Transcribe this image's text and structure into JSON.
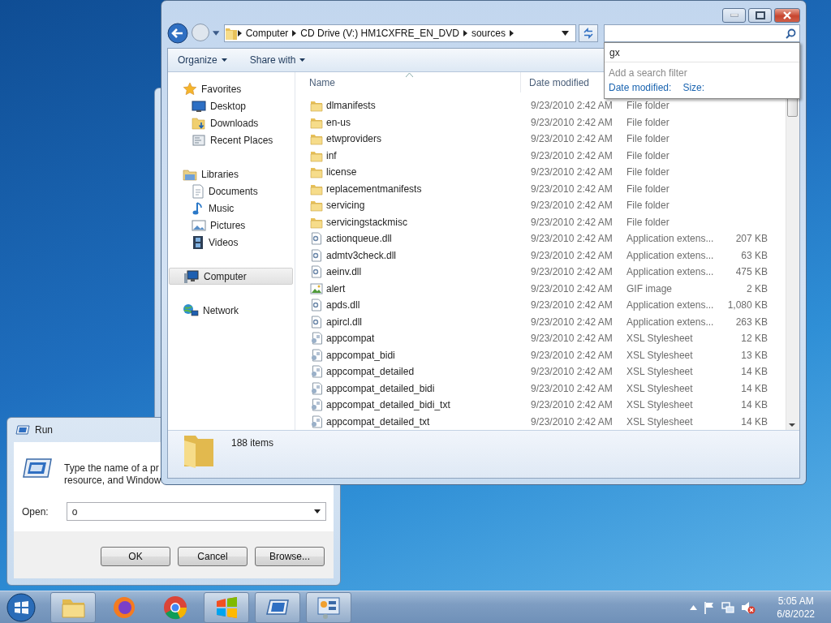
{
  "explorer": {
    "breadcrumbs": [
      "Computer",
      "CD Drive (V:) HM1CXFRE_EN_DVD",
      "sources"
    ],
    "search_dropdown": {
      "history": [
        "gx"
      ],
      "hint": "Add a search filter",
      "filters": [
        "Date modified:",
        "Size:"
      ]
    },
    "toolbar": [
      "Organize",
      "Share with"
    ],
    "sidebar": [
      {
        "label": "Favorites",
        "selected": false,
        "children": [
          {
            "label": "Desktop",
            "selected": false
          },
          {
            "label": "Downloads",
            "selected": false
          },
          {
            "label": "Recent Places",
            "selected": false
          }
        ]
      },
      {
        "label": "Libraries",
        "selected": false,
        "children": [
          {
            "label": "Documents",
            "selected": false
          },
          {
            "label": "Music",
            "selected": false
          },
          {
            "label": "Pictures",
            "selected": false
          },
          {
            "label": "Videos",
            "selected": false
          }
        ]
      },
      {
        "label": "Computer",
        "selected": true
      },
      {
        "label": "Network",
        "selected": false
      }
    ],
    "columns": [
      "Name",
      "Date modified"
    ],
    "rows": [
      {
        "kind": "folder",
        "name": "dlmanifests",
        "date": "9/23/2010 2:42 AM",
        "type": "File folder"
      },
      {
        "kind": "folder",
        "name": "en-us",
        "date": "9/23/2010 2:42 AM",
        "type": "File folder"
      },
      {
        "kind": "folder",
        "name": "etwproviders",
        "date": "9/23/2010 2:42 AM",
        "type": "File folder"
      },
      {
        "kind": "folder",
        "name": "inf",
        "date": "9/23/2010 2:42 AM",
        "type": "File folder"
      },
      {
        "kind": "folder",
        "name": "license",
        "date": "9/23/2010 2:42 AM",
        "type": "File folder"
      },
      {
        "kind": "folder",
        "name": "replacementmanifests",
        "date": "9/23/2010 2:42 AM",
        "type": "File folder"
      },
      {
        "kind": "folder",
        "name": "servicing",
        "date": "9/23/2010 2:42 AM",
        "type": "File folder"
      },
      {
        "kind": "folder",
        "name": "servicingstackmisc",
        "date": "9/23/2010 2:42 AM",
        "type": "File folder"
      },
      {
        "kind": "dll",
        "name": "actionqueue.dll",
        "date": "9/23/2010 2:42 AM",
        "type": "Application extens...",
        "size": "207 KB"
      },
      {
        "kind": "dll",
        "name": "admtv3check.dll",
        "date": "9/23/2010 2:42 AM",
        "type": "Application extens...",
        "size": "63 KB"
      },
      {
        "kind": "dll",
        "name": "aeinv.dll",
        "date": "9/23/2010 2:42 AM",
        "type": "Application extens...",
        "size": "475 KB"
      },
      {
        "kind": "image",
        "name": "alert",
        "date": "9/23/2010 2:42 AM",
        "type": "GIF image",
        "size": "2 KB"
      },
      {
        "kind": "dll",
        "name": "apds.dll",
        "date": "9/23/2010 2:42 AM",
        "type": "Application extens...",
        "size": "1,080 KB"
      },
      {
        "kind": "dll",
        "name": "apircl.dll",
        "date": "9/23/2010 2:42 AM",
        "type": "Application extens...",
        "size": "263 KB"
      },
      {
        "kind": "xsl",
        "name": "appcompat",
        "date": "9/23/2010 2:42 AM",
        "type": "XSL Stylesheet",
        "size": "12 KB"
      },
      {
        "kind": "xsl",
        "name": "appcompat_bidi",
        "date": "9/23/2010 2:42 AM",
        "type": "XSL Stylesheet",
        "size": "13 KB"
      },
      {
        "kind": "xsl",
        "name": "appcompat_detailed",
        "date": "9/23/2010 2:42 AM",
        "type": "XSL Stylesheet",
        "size": "14 KB"
      },
      {
        "kind": "xsl",
        "name": "appcompat_detailed_bidi",
        "date": "9/23/2010 2:42 AM",
        "type": "XSL Stylesheet",
        "size": "14 KB"
      },
      {
        "kind": "xsl",
        "name": "appcompat_detailed_bidi_txt",
        "date": "9/23/2010 2:42 AM",
        "type": "XSL Stylesheet",
        "size": "14 KB"
      },
      {
        "kind": "xsl",
        "name": "appcompat_detailed_txt",
        "date": "9/23/2010 2:42 AM",
        "type": "XSL Stylesheet",
        "size": "14 KB"
      }
    ],
    "status": "188 items"
  },
  "run_dialog": {
    "title": "Run",
    "description": [
      "Type the name of a pr",
      "resource, and Window"
    ],
    "open_label": "Open:",
    "open_value": "o",
    "buttons": [
      "OK",
      "Cancel",
      "Browse..."
    ]
  },
  "taskbar": {
    "apps": [
      {
        "kind": "explorer",
        "running": true
      },
      {
        "kind": "firefox",
        "running": false
      },
      {
        "kind": "chrome",
        "running": false
      },
      {
        "kind": "windows",
        "running": true
      },
      {
        "kind": "run",
        "running": true
      },
      {
        "kind": "control",
        "running": true
      }
    ],
    "time": "5:05 AM",
    "date": "6/8/2022"
  }
}
